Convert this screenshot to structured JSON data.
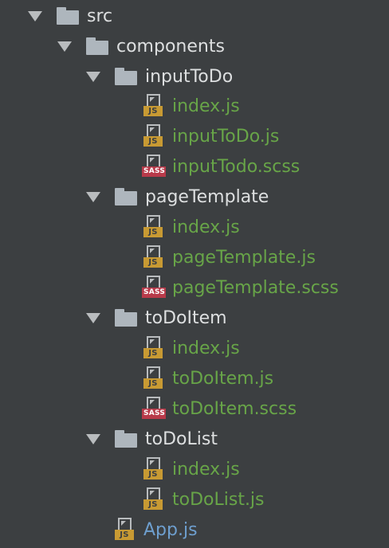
{
  "tree": {
    "root": {
      "label": "src"
    },
    "components": {
      "label": "components"
    },
    "inputToDo": {
      "label": "inputToDo",
      "files": [
        {
          "label": "index.js",
          "badge": "JS"
        },
        {
          "label": "inputToDo.js",
          "badge": "JS"
        },
        {
          "label": "inputTodo.scss",
          "badge": "SASS"
        }
      ]
    },
    "pageTemplate": {
      "label": "pageTemplate",
      "files": [
        {
          "label": "index.js",
          "badge": "JS"
        },
        {
          "label": "pageTemplate.js",
          "badge": "JS"
        },
        {
          "label": "pageTemplate.scss",
          "badge": "SASS"
        }
      ]
    },
    "toDoItem": {
      "label": "toDoItem",
      "files": [
        {
          "label": "index.js",
          "badge": "JS"
        },
        {
          "label": "toDoItem.js",
          "badge": "JS"
        },
        {
          "label": "toDoItem.scss",
          "badge": "SASS"
        }
      ]
    },
    "toDoList": {
      "label": "toDoList",
      "files": [
        {
          "label": "index.js",
          "badge": "JS"
        },
        {
          "label": "toDoList.js",
          "badge": "JS"
        }
      ]
    },
    "app": {
      "label": "App.js",
      "badge": "JS"
    }
  },
  "colors": {
    "background": "#3c3f41",
    "folder_text": "#dddfe0",
    "modified_file": "#68a548",
    "changed_file": "#6e9fcf",
    "js_badge": "#c89a33",
    "sass_badge": "#b83a4a"
  },
  "icons": {
    "expanded": "chevron-down-icon",
    "folder": "folder-icon",
    "js": "js-file-icon",
    "sass": "sass-file-icon"
  }
}
